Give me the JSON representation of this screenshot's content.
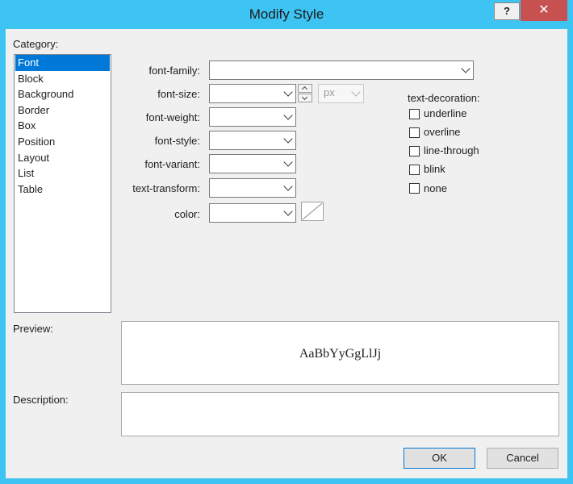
{
  "window": {
    "title": "Modify Style",
    "help_label": "?",
    "close_label": "✕"
  },
  "category": {
    "label": "Category:",
    "items": [
      "Font",
      "Block",
      "Background",
      "Border",
      "Box",
      "Position",
      "Layout",
      "List",
      "Table"
    ],
    "selected": "Font"
  },
  "font": {
    "family_label": "font-family:",
    "family_value": "",
    "size_label": "font-size:",
    "size_value": "",
    "size_unit": "px",
    "weight_label": "font-weight:",
    "weight_value": "",
    "style_label": "font-style:",
    "style_value": "",
    "variant_label": "font-variant:",
    "variant_value": "",
    "transform_label": "text-transform:",
    "transform_value": "",
    "color_label": "color:",
    "color_value": ""
  },
  "decoration": {
    "label": "text-decoration:",
    "options": [
      {
        "label": "underline",
        "checked": false
      },
      {
        "label": "overline",
        "checked": false
      },
      {
        "label": "line-through",
        "checked": false
      },
      {
        "label": "blink",
        "checked": false
      },
      {
        "label": "none",
        "checked": false
      }
    ]
  },
  "preview": {
    "label": "Preview:",
    "sample": "AaBbYyGgLlJj"
  },
  "description": {
    "label": "Description:",
    "text": ""
  },
  "buttons": {
    "ok": "OK",
    "cancel": "Cancel"
  },
  "colors": {
    "titlebar": "#3ec4f2",
    "close": "#c75050",
    "selection": "#0078d7"
  }
}
